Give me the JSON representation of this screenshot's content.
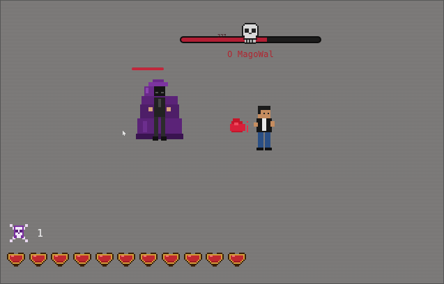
{
  "boss": {
    "name": "O MagoWal",
    "hp_text": "227",
    "hp_fraction": 0.62,
    "bar_color": "#b21e34",
    "icon": "skull-icon"
  },
  "enemy": {
    "name": "purple-hooded-wizard",
    "hp_fraction": 1.0,
    "hp_color": "#c0283c"
  },
  "player": {
    "name": "player-character",
    "action": "punch"
  },
  "hud": {
    "kill_icon": "skull-crossbones-icon",
    "kill_count": "1",
    "hearts_count": 11,
    "heart_icon": "heart-icon"
  }
}
